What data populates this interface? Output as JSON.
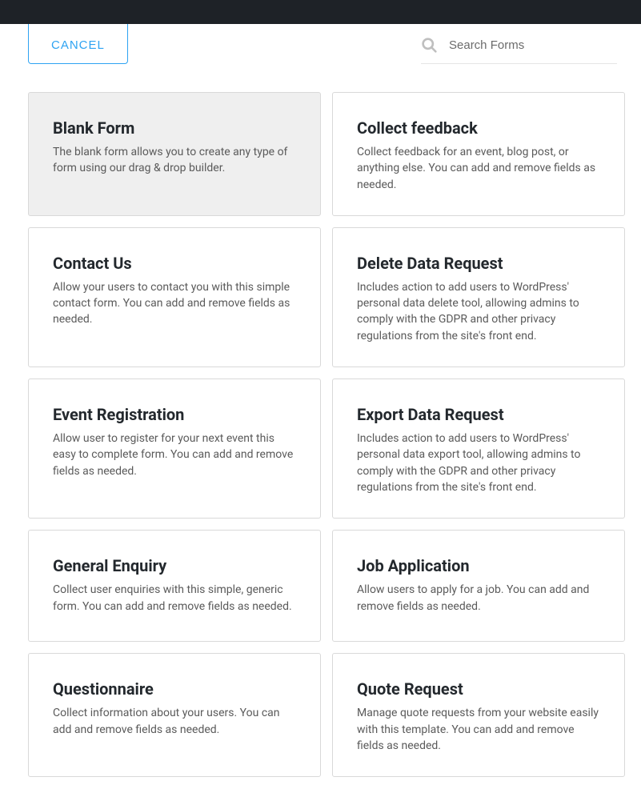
{
  "header": {
    "cancel_label": "CANCEL"
  },
  "search": {
    "placeholder": "Search Forms"
  },
  "templates": [
    {
      "title": "Blank Form",
      "description": "The blank form allows you to create any type of form using our drag & drop builder.",
      "selected": true
    },
    {
      "title": "Collect feedback",
      "description": "Collect feedback for an event, blog post, or anything else. You can add and remove fields as needed.",
      "selected": false
    },
    {
      "title": "Contact Us",
      "description": "Allow your users to contact you with this simple contact form. You can add and remove fields as needed.",
      "selected": false
    },
    {
      "title": "Delete Data Request",
      "description": "Includes action to add users to WordPress' personal data delete tool, allowing admins to comply with the GDPR and other privacy regulations from the site's front end.",
      "selected": false
    },
    {
      "title": "Event Registration",
      "description": "Allow user to register for your next event this easy to complete form. You can add and remove fields as needed.",
      "selected": false
    },
    {
      "title": "Export Data Request",
      "description": "Includes action to add users to WordPress' personal data export tool, allowing admins to comply with the GDPR and other privacy regulations from the site's front end.",
      "selected": false
    },
    {
      "title": "General Enquiry",
      "description": "Collect user enquiries with this simple, generic form. You can add and remove fields as needed.",
      "selected": false
    },
    {
      "title": "Job Application",
      "description": "Allow users to apply for a job. You can add and remove fields as needed.",
      "selected": false
    },
    {
      "title": "Questionnaire",
      "description": "Collect information about your users. You can add and remove fields as needed.",
      "selected": false
    },
    {
      "title": "Quote Request",
      "description": "Manage quote requests from your website easily with this template. You can add and remove fields as needed.",
      "selected": false
    }
  ]
}
